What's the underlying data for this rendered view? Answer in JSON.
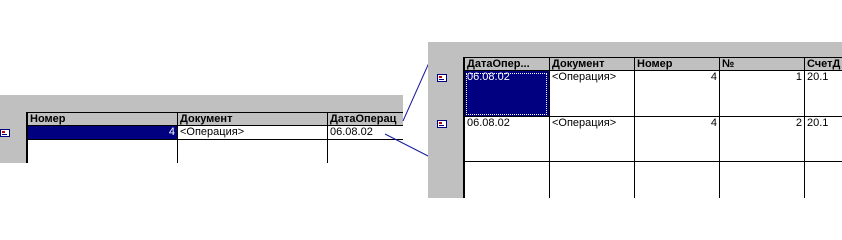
{
  "small_grid": {
    "columns": [
      "Номер",
      "Документ",
      "ДатаОперац"
    ],
    "rows": [
      {
        "number": "4",
        "document": "<Операция>",
        "date": "06.08.02"
      }
    ]
  },
  "large_grid": {
    "columns": [
      "ДатаОпер...",
      "Документ",
      "Номер",
      "№",
      "СчетД"
    ],
    "rows": [
      {
        "date": "06.08.02",
        "document": "<Операция>",
        "number": "4",
        "no": "1",
        "account": "20.1"
      },
      {
        "date": "06.08.02",
        "document": "<Операция>",
        "number": "4",
        "no": "2",
        "account": "20.1"
      }
    ]
  },
  "colors": {
    "grid_gray": "#c0c0c0",
    "selection": "#000080",
    "connector": "#1a1aa0"
  },
  "icons": [
    "operation-row-icon"
  ]
}
